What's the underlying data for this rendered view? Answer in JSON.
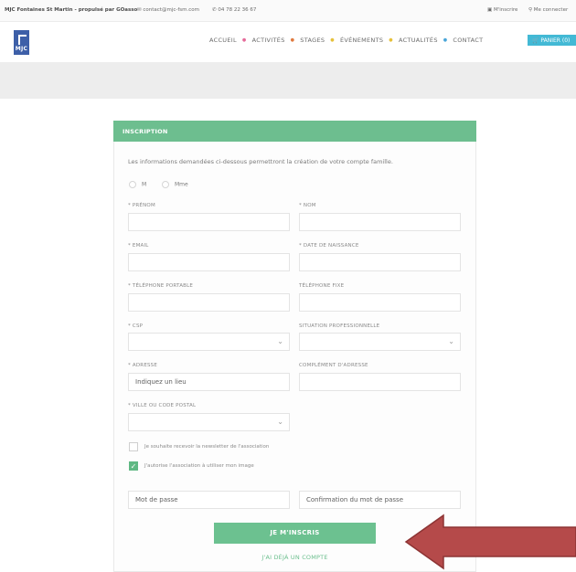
{
  "topbar": {
    "site": "MJC Fontaines St Martin - propulsé par GOasso",
    "email": "contact@mjc-fsm.com",
    "phone": "04 78 22 36 67",
    "signup": "M'inscrire",
    "login": "Me connecter"
  },
  "header": {
    "logo_text": "MJC",
    "nav": [
      "ACCUEIL",
      "ACTIVITÉS",
      "STAGES",
      "ÉVÉNEMENTS",
      "ACTUALITÉS",
      "CONTACT"
    ],
    "cart": "PANIER (0)"
  },
  "form": {
    "title": "INSCRIPTION",
    "intro": "Les informations demandées ci-dessous permettront la création de votre compte famille.",
    "radios": [
      "M",
      "Mme"
    ],
    "labels": {
      "prenom": "* PRÉNOM",
      "nom": "* NOM",
      "email": "* EMAIL",
      "naissance": "* DATE DE NAISSANCE",
      "tel_portable": "* TÉLÉPHONE PORTABLE",
      "tel_fixe": "TÉLÉPHONE FIXE",
      "csp": "* CSP",
      "situation": "SITUATION PROFESSIONNELLE",
      "adresse": "* ADRESSE",
      "complement": "COMPLÉMENT D'ADRESSE",
      "ville": "* VILLE OU CODE POSTAL"
    },
    "adresse_placeholder": "Indiquez un lieu",
    "newsletter": "Je souhaite recevoir la newsletter de l'association",
    "image_consent": "J'autorise l'association à utiliser mon image",
    "password_placeholder": "Mot de passe",
    "confirm_placeholder": "Confirmation du mot de passe",
    "submit": "JE M'INSCRIS",
    "already": "J'AI DÉJÀ UN COMPTE"
  },
  "colors": {
    "accent_green": "#6dbe8f",
    "cart_blue": "#43b9d5",
    "arrow_red": "#b54a4a"
  }
}
